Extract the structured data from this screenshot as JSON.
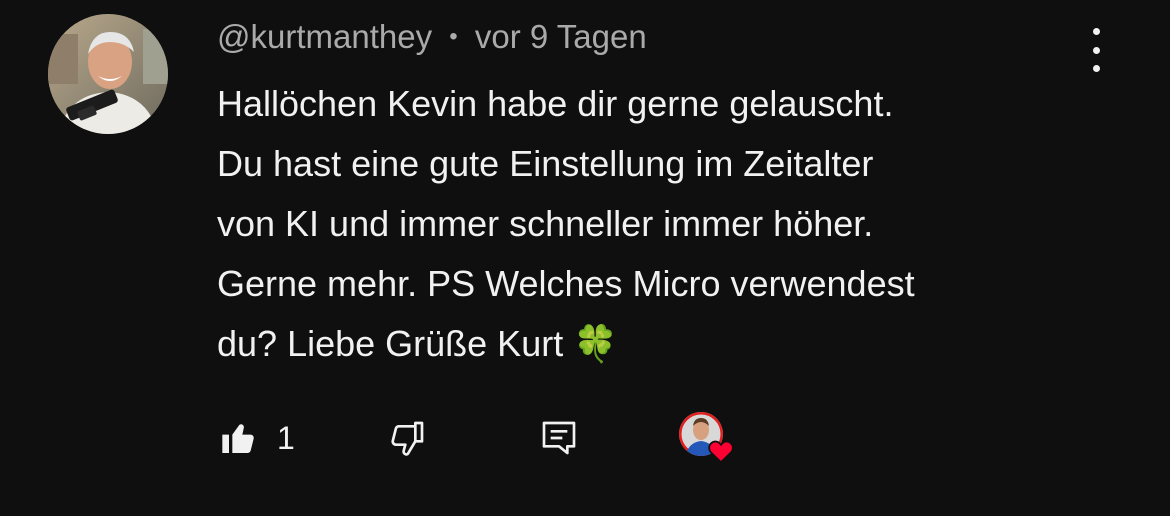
{
  "comment": {
    "author": "@kurtmanthey",
    "separator": "•",
    "time": "vor 9 Tagen",
    "text_lines": [
      "Hallöchen Kevin habe dir gerne gelauscht.",
      "Du hast eine gute Einstellung im Zeitalter",
      "von KI und immer schneller immer höher.",
      "Gerne mehr. PS Welches Micro verwendest",
      "du? Liebe Grüße Kurt 🍀"
    ],
    "like_count": "1"
  },
  "icons": {
    "avatar": "user-avatar",
    "menu": "more-vert-icon",
    "like": "thumb-up-icon",
    "dislike": "thumb-down-icon",
    "reply": "reply-comment-icon",
    "creator_heart": "creator-heart-icon"
  },
  "colors": {
    "background": "#0f0f0f",
    "text": "#f1f1f1",
    "meta": "#aaaaaa",
    "heart": "#ff0033"
  }
}
